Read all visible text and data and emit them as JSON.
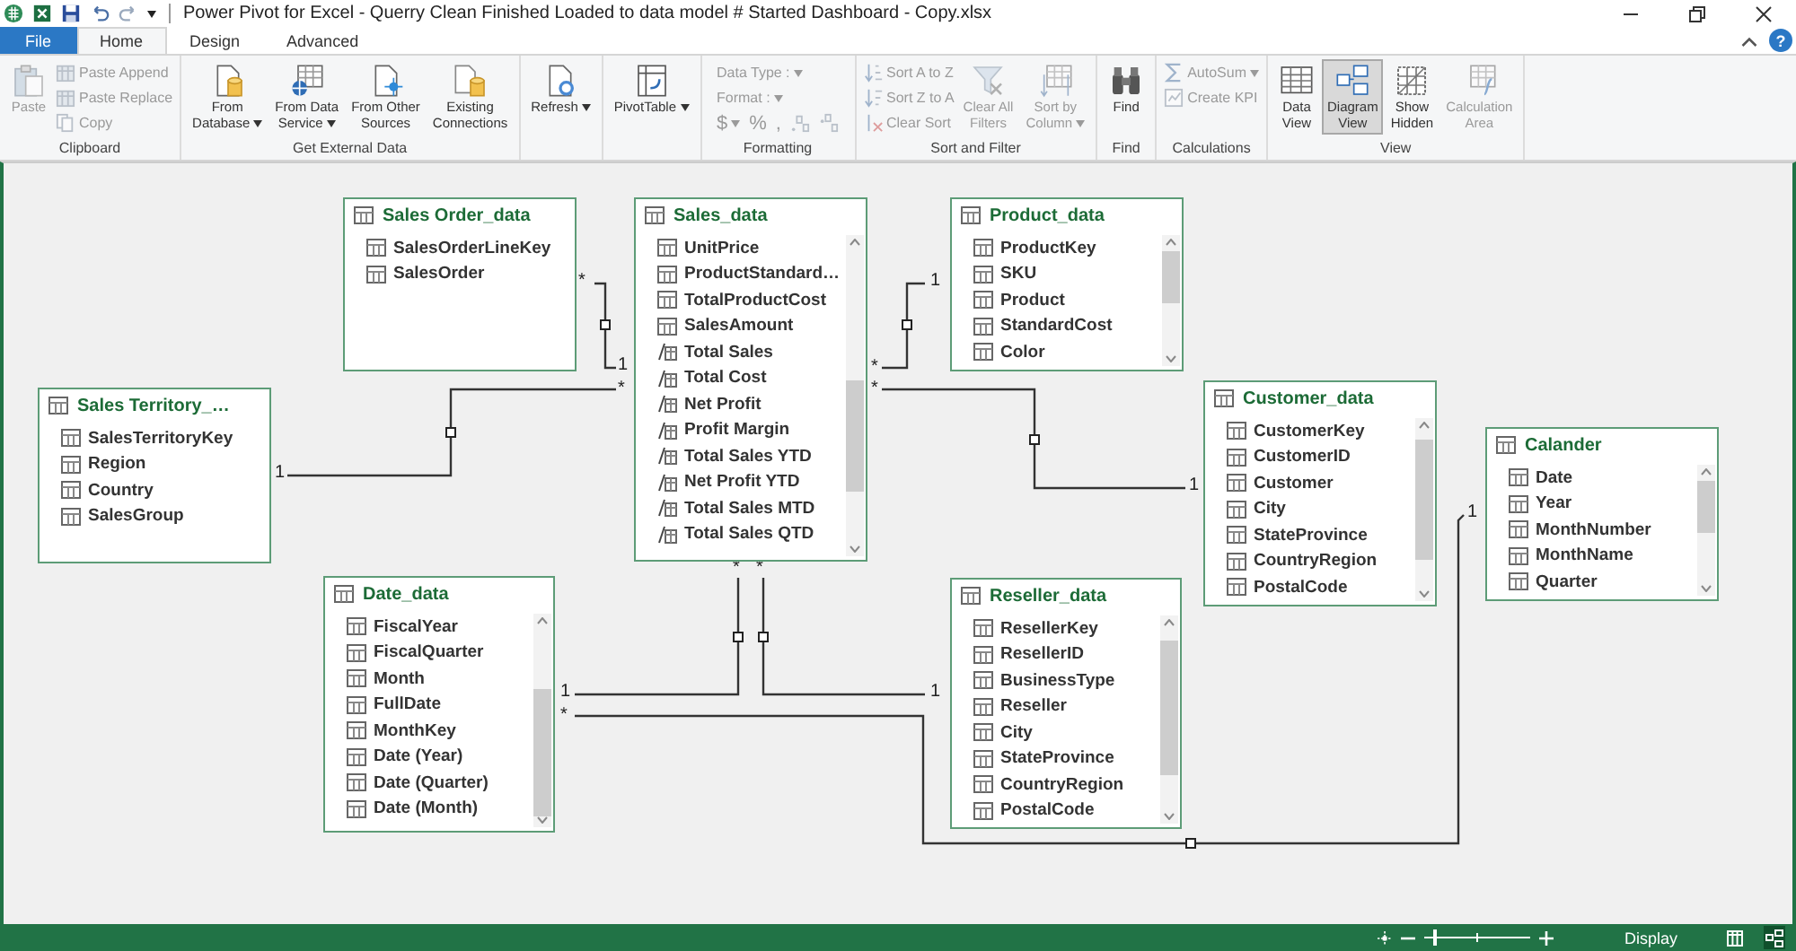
{
  "title_bar": {
    "title": "Power Pivot for Excel - Querry Clean Finished Loaded to data model # Started Dashboard - Copy.xlsx",
    "help": "?"
  },
  "tabs": [
    {
      "label": "File",
      "kind": "file",
      "selected": false
    },
    {
      "label": "Home",
      "kind": "tab",
      "selected": true
    },
    {
      "label": "Design",
      "kind": "tab",
      "selected": false
    },
    {
      "label": "Advanced",
      "kind": "tab",
      "selected": false
    }
  ],
  "ribbon": [
    {
      "label": "Clipboard",
      "items": [
        {
          "kind": "large",
          "label": "Paste",
          "disabled": true
        },
        {
          "kind": "stack",
          "rows": [
            [
              {
                "kind": "small",
                "label": "Paste Append",
                "disabled": true
              }
            ],
            [
              {
                "kind": "small",
                "label": "Paste Replace",
                "disabled": true
              }
            ],
            [
              {
                "kind": "small",
                "label": "Copy",
                "disabled": true
              }
            ]
          ]
        }
      ]
    },
    {
      "label": "Get External Data",
      "items": [
        {
          "kind": "large",
          "label": "From\nDatabase",
          "dropdown": true,
          "disabled": false
        },
        {
          "kind": "large",
          "label": "From Data\nService",
          "dropdown": true,
          "disabled": false
        },
        {
          "kind": "large",
          "label": "From Other\nSources",
          "disabled": false
        },
        {
          "kind": "large",
          "label": "Existing\nConnections",
          "disabled": false
        }
      ]
    },
    {
      "items": [
        {
          "kind": "large",
          "label": "Refresh",
          "dropdown": true,
          "disabled": false
        }
      ]
    },
    {
      "items": [
        {
          "kind": "large",
          "label": "PivotTable",
          "dropdown": true,
          "disabled": false
        }
      ]
    },
    {
      "label": "Formatting",
      "items": [
        {
          "kind": "stack",
          "rows": [
            [
              {
                "kind": "text",
                "label": "Data Type :",
                "dropdown": true,
                "disabled": true
              }
            ],
            [
              {
                "kind": "text",
                "label": "Format :",
                "dropdown": true,
                "disabled": true
              }
            ],
            [
              {
                "kind": "symbol",
                "label": "$",
                "dropdown": true,
                "disabled": true
              },
              {
                "kind": "symbol",
                "label": "%",
                "disabled": true
              },
              {
                "kind": "symbol",
                "label": ",",
                "disabled": true
              },
              {
                "kind": "icon_only",
                "disabled": true
              },
              {
                "kind": "icon_only",
                "disabled": true
              }
            ]
          ]
        }
      ]
    },
    {
      "label": "Sort and Filter",
      "items": [
        {
          "kind": "stack",
          "rows": [
            [
              {
                "kind": "small",
                "label": "Sort A to Z",
                "disabled": true
              }
            ],
            [
              {
                "kind": "small",
                "label": "Sort Z to A",
                "disabled": true
              }
            ],
            [
              {
                "kind": "small",
                "label": "Clear Sort",
                "disabled": true
              }
            ]
          ]
        },
        {
          "kind": "large",
          "label": "Clear All\nFilters",
          "disabled": true
        },
        {
          "kind": "large",
          "label": "Sort by\nColumn",
          "dropdown": true,
          "disabled": true
        }
      ]
    },
    {
      "label": "Find",
      "items": [
        {
          "kind": "large",
          "label": "Find",
          "disabled": false
        }
      ]
    },
    {
      "label": "Calculations",
      "items": [
        {
          "kind": "stack",
          "rows": [
            [
              {
                "kind": "small",
                "label": "AutoSum",
                "dropdown": true,
                "disabled": true
              }
            ],
            [
              {
                "kind": "small",
                "label": "Create KPI",
                "disabled": true
              }
            ]
          ]
        }
      ]
    },
    {
      "label": "View",
      "items": [
        {
          "kind": "large",
          "label": "Data\nView",
          "disabled": false,
          "selected": false
        },
        {
          "kind": "large",
          "label": "Diagram\nView",
          "disabled": false,
          "selected": true
        },
        {
          "kind": "large",
          "label": "Show\nHidden",
          "disabled": false,
          "selected": false
        },
        {
          "kind": "large",
          "label": "Calculation\nArea",
          "disabled": true,
          "selected": false
        }
      ]
    }
  ],
  "diagram": {
    "tables": [
      {
        "name": "Sales Order_data",
        "scrollable": false,
        "fields": [
          {
            "label": "SalesOrderLineKey",
            "kind": "column"
          },
          {
            "label": "SalesOrder",
            "kind": "column"
          }
        ]
      },
      {
        "name": "Sales_data",
        "scrollable": true,
        "fields": [
          {
            "label": "UnitPrice",
            "kind": "column"
          },
          {
            "label": "ProductStandard…",
            "kind": "column"
          },
          {
            "label": "TotalProductCost",
            "kind": "column"
          },
          {
            "label": "SalesAmount",
            "kind": "column"
          },
          {
            "label": "Total Sales",
            "kind": "measure"
          },
          {
            "label": "Total Cost",
            "kind": "measure"
          },
          {
            "label": "Net Profit",
            "kind": "measure"
          },
          {
            "label": "Profit Margin",
            "kind": "measure"
          },
          {
            "label": "Total Sales YTD",
            "kind": "measure"
          },
          {
            "label": "Net Profit YTD",
            "kind": "measure"
          },
          {
            "label": "Total Sales MTD",
            "kind": "measure"
          },
          {
            "label": "Total Sales QTD",
            "kind": "measure"
          }
        ]
      },
      {
        "name": "Product_data",
        "scrollable": true,
        "fields": [
          {
            "label": "ProductKey",
            "kind": "column"
          },
          {
            "label": "SKU",
            "kind": "column"
          },
          {
            "label": "Product",
            "kind": "column"
          },
          {
            "label": "StandardCost",
            "kind": "column"
          },
          {
            "label": "Color",
            "kind": "column"
          }
        ]
      },
      {
        "name": "Sales Territory_…",
        "scrollable": false,
        "fields": [
          {
            "label": "SalesTerritoryKey",
            "kind": "column"
          },
          {
            "label": "Region",
            "kind": "column"
          },
          {
            "label": "Country",
            "kind": "column"
          },
          {
            "label": "SalesGroup",
            "kind": "column"
          }
        ]
      },
      {
        "name": "Customer_data",
        "scrollable": true,
        "fields": [
          {
            "label": "CustomerKey",
            "kind": "column"
          },
          {
            "label": "CustomerID",
            "kind": "column"
          },
          {
            "label": "Customer",
            "kind": "column"
          },
          {
            "label": "City",
            "kind": "column"
          },
          {
            "label": "StateProvince",
            "kind": "column"
          },
          {
            "label": "CountryRegion",
            "kind": "column"
          },
          {
            "label": "PostalCode",
            "kind": "column"
          }
        ]
      },
      {
        "name": "Calander",
        "scrollable": true,
        "fields": [
          {
            "label": "Date",
            "kind": "column"
          },
          {
            "label": "Year",
            "kind": "column"
          },
          {
            "label": "MonthNumber",
            "kind": "column"
          },
          {
            "label": "MonthName",
            "kind": "column"
          },
          {
            "label": "Quarter",
            "kind": "column"
          }
        ]
      },
      {
        "name": "Date_data",
        "scrollable": true,
        "fields": [
          {
            "label": "FiscalYear",
            "kind": "column"
          },
          {
            "label": "FiscalQuarter",
            "kind": "column"
          },
          {
            "label": "Month",
            "kind": "column"
          },
          {
            "label": "FullDate",
            "kind": "column"
          },
          {
            "label": "MonthKey",
            "kind": "column"
          },
          {
            "label": "Date (Year)",
            "kind": "column"
          },
          {
            "label": "Date (Quarter)",
            "kind": "column"
          },
          {
            "label": "Date (Month)",
            "kind": "column"
          }
        ]
      },
      {
        "name": "Reseller_data",
        "scrollable": true,
        "fields": [
          {
            "label": "ResellerKey",
            "kind": "column"
          },
          {
            "label": "ResellerID",
            "kind": "column"
          },
          {
            "label": "BusinessType",
            "kind": "column"
          },
          {
            "label": "Reseller",
            "kind": "column"
          },
          {
            "label": "City",
            "kind": "column"
          },
          {
            "label": "StateProvince",
            "kind": "column"
          },
          {
            "label": "CountryRegion",
            "kind": "column"
          },
          {
            "label": "PostalCode",
            "kind": "column"
          }
        ]
      }
    ],
    "relationships": [
      {
        "many": "*",
        "one": "1"
      },
      {
        "many": "*",
        "one": "1"
      },
      {
        "many": "*",
        "one": "1"
      },
      {
        "many": "*",
        "one": "1"
      },
      {
        "many": "*",
        "one": "1"
      },
      {
        "many": "*",
        "one": "1"
      },
      {
        "many": "*",
        "one": "1"
      }
    ]
  },
  "status_bar": {
    "zoom": {
      "level": 0.1
    },
    "label": "Display",
    "views": [
      {
        "selected": false
      },
      {
        "selected": true
      }
    ]
  }
}
